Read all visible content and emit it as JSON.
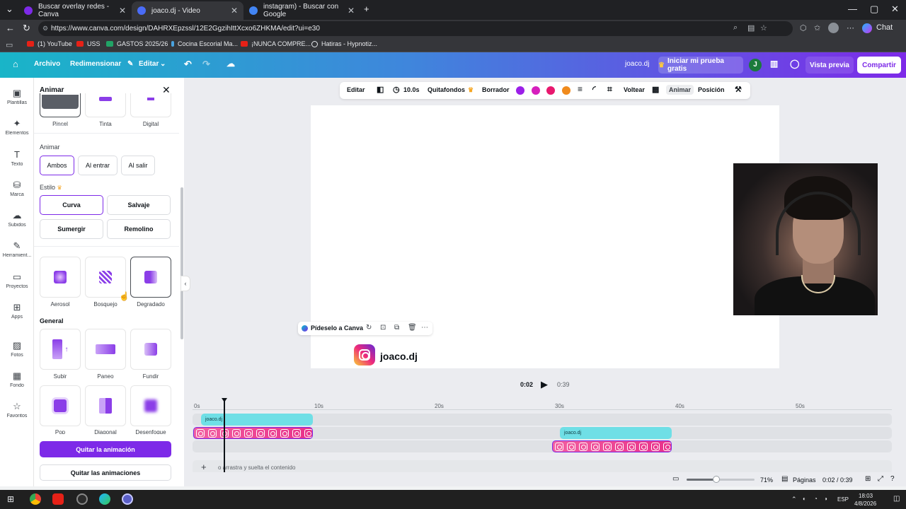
{
  "browser": {
    "tabs": [
      {
        "title": "Buscar overlay redes - Canva",
        "color": "#7d2ae8"
      },
      {
        "title": "joaco.dj - Video",
        "color": "#4a6cf7"
      },
      {
        "title": "instagram) - Buscar con Google",
        "color": "#4285f4"
      }
    ],
    "url": "https://www.canva.com/design/DAHRXEpzssl/12E2GgzihIttXcxo6ZHKMA/edit?ui=e30",
    "bookmarks": [
      "(1) YouTube",
      "USS",
      "GASTOS 2025/26",
      "Cocina Escorial Ma...",
      "¡NUNCA COMPRE...",
      "Hatiras - Hypnotiz..."
    ],
    "chat_label": "Chat"
  },
  "header": {
    "archivo": "Archivo",
    "redimensionar": "Redimensionar",
    "editar": "Editar",
    "design_name": "joaco.dj",
    "trial": "Iniciar mi prueba gratis",
    "avatar_initial": "J",
    "preview": "Vista previa",
    "share": "Compartir"
  },
  "rail": [
    "Plantillas",
    "Elementos",
    "Texto",
    "Marca",
    "Subidos",
    "Herramient...",
    "Proyectos",
    "Apps",
    "Fotos",
    "Fondo",
    "Favoritos"
  ],
  "panel": {
    "title": "Animar",
    "top_tiles": [
      "Pincel",
      "Tinta",
      "Digital"
    ],
    "animate_label": "Animar",
    "animate_options": [
      "Ambos",
      "Al entrar",
      "Al salir"
    ],
    "style_label": "Estilo",
    "style_options": [
      "Curva",
      "Salvaje",
      "Sumergir",
      "Remolino"
    ],
    "effect_tiles": [
      "Aerosol",
      "Bosquejo",
      "Degradado"
    ],
    "general_label": "General",
    "general_tiles_row1": [
      "Subir",
      "Paneo",
      "Fundir"
    ],
    "general_tiles_row2": [
      "Pop",
      "Diagonal",
      "Desenfoque"
    ],
    "remove_button": "Quitar la animación",
    "remove_all_button": "Quitar las animaciones"
  },
  "toolbar": {
    "editar": "Editar",
    "duration": "10.0s",
    "quitafondos": "Quitafondos",
    "borrador": "Borrador",
    "swatches": [
      "#9b1fe8",
      "#d61fbd",
      "#e8186e",
      "#f08a1c"
    ],
    "voltear": "Voltear",
    "animar": "Animar",
    "posicion": "Posición"
  },
  "canvas": {
    "magic_label": "Pídeselo a Canva",
    "handle": "joaco.dj"
  },
  "playback": {
    "current": "0:02",
    "duration": "0:39"
  },
  "timeline": {
    "ticks": [
      "0s",
      "10s",
      "20s",
      "30s",
      "40s",
      "50s"
    ],
    "clip_labels": [
      "joaco.dj",
      "joaco.dj"
    ],
    "drop_hint": "o arrastra y suelta el contenido"
  },
  "footer": {
    "zoom": "71%",
    "zoom_fraction": 0.44,
    "pages": "Páginas",
    "time": "0:02 / 0:39"
  },
  "taskbar": {
    "lang": "ESP",
    "time": "18:03",
    "date": "4/8/2026"
  }
}
